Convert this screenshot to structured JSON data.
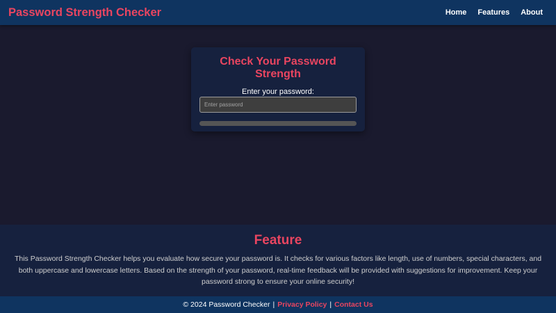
{
  "header": {
    "brand": "Password Strength Checker",
    "nav": [
      {
        "label": "Home"
      },
      {
        "label": "Features"
      },
      {
        "label": "About"
      }
    ]
  },
  "checker": {
    "title": "Check Your Password Strength",
    "label": "Enter your password:",
    "input_value": "",
    "placeholder": "Enter password",
    "strength_percent": 0
  },
  "feature": {
    "title": "Feature",
    "text": "This Password Strength Checker helps you evaluate how secure your password is. It checks for various factors like length, use of numbers, special characters, and both uppercase and lowercase letters. Based on the strength of your password, real-time feedback will be provided with suggestions for improvement. Keep your password strong to ensure your online security!"
  },
  "footer": {
    "copyright": "© 2024 Password Checker",
    "separator": "|",
    "links": [
      {
        "label": "Privacy Policy"
      },
      {
        "label": "Contact Us"
      }
    ]
  },
  "colors": {
    "accent": "#e94560",
    "nav_bg": "#0f3460",
    "panel_bg": "#16213e",
    "page_bg": "#1a1a2e",
    "track": "#555555"
  }
}
